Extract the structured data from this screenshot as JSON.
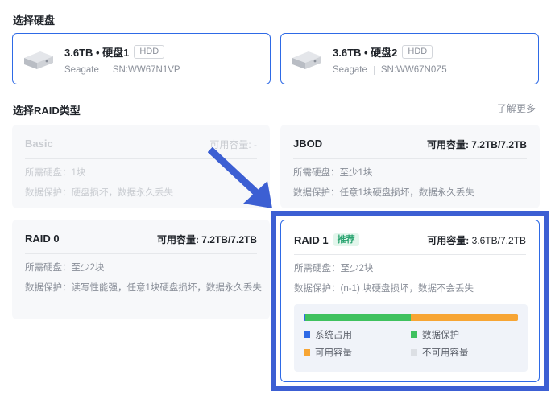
{
  "disk_section": {
    "title": "选择硬盘"
  },
  "disks": [
    {
      "title": "3.6TB • 硬盘1",
      "type": "HDD",
      "brand": "Seagate",
      "sn": "SN:WW67N1VP"
    },
    {
      "title": "3.6TB • 硬盘2",
      "type": "HDD",
      "brand": "Seagate",
      "sn": "SN:WW67N0Z5"
    }
  ],
  "raid_section": {
    "title": "选择RAID类型",
    "learn_more": "了解更多"
  },
  "raid_types": {
    "basic": {
      "name": "Basic",
      "cap_label": "可用容量: -",
      "cap_value": "",
      "req": "所需硬盘：1块",
      "protect": "数据保护：硬盘损坏，数据永久丢失",
      "enabled": false
    },
    "jbod": {
      "name": "JBOD",
      "cap_label": "可用容量: ",
      "cap_value": "7.2TB/7.2TB",
      "req": "所需硬盘：至少1块",
      "protect": "数据保护：任意1块硬盘损坏，数据永久丢失",
      "enabled": true
    },
    "raid0": {
      "name": "RAID 0",
      "cap_label": "可用容量: ",
      "cap_value": "7.2TB/7.2TB",
      "req": "所需硬盘：至少2块",
      "protect": "数据保护：读写性能强，任意1块硬盘损坏，数据永久丢失",
      "enabled": true
    },
    "raid1": {
      "name": "RAID 1",
      "tag": "推荐",
      "cap_label": "可用容量: ",
      "cap_value": "3.6TB/7.2TB",
      "req": "所需硬盘：至少2块",
      "protect": "数据保护：(n-1) 块硬盘损坏，数据不会丢失",
      "enabled": true,
      "selected": true
    }
  },
  "usage_bar": {
    "segments": [
      {
        "name": "系统占用",
        "fraction": 0.006,
        "color": "#2e6ae6"
      },
      {
        "name": "数据保护",
        "fraction": 0.494,
        "color": "#3fc15f"
      },
      {
        "name": "可用容量",
        "fraction": 0.5,
        "color": "#f7a534"
      },
      {
        "name": "不可用容量",
        "fraction": 0.0,
        "color": "#dcdfe4"
      }
    ]
  },
  "colors": {
    "accent": "#2e6ae6",
    "highlight": "#3c5fd3",
    "recommend": "#2ba471"
  },
  "icons": {
    "disk": "hdd-icon",
    "arrow": "arrow-icon"
  }
}
